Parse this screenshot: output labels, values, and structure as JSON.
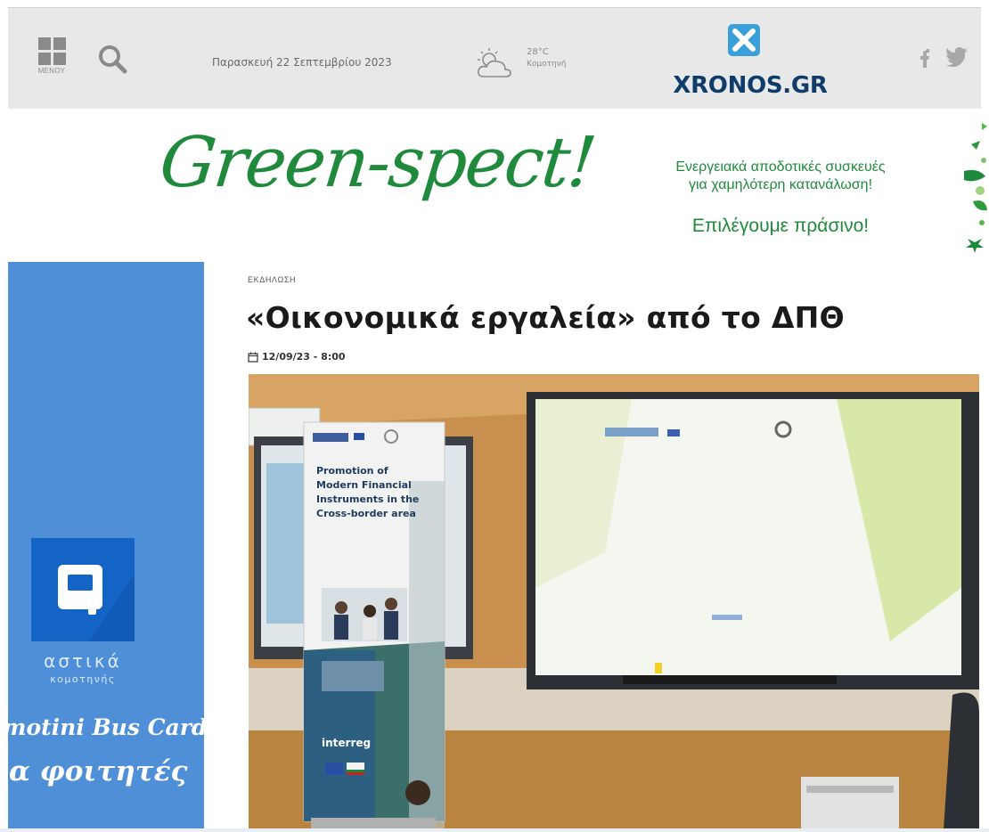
{
  "header": {
    "menu_label": "ΜΕΝΟΥ",
    "date": "Παρασκευή 22 Σεπτεμβρίου 2023",
    "weather": {
      "temperature": "28°C",
      "city": "Κομοτηνή",
      "icon": "partly-cloudy-icon"
    },
    "logo_text": "XRONOS.GR",
    "social": [
      "facebook-icon",
      "twitter-icon"
    ],
    "background": "#e8e8e8",
    "logo_color": "#0e3d6b"
  },
  "banner": {
    "headline": "Green-spect!",
    "line1": "Ενεργειακά αποδοτικές συσκευές",
    "line2": "για χαμηλότερη κατανάλωση!",
    "cta": "Επιλέγουμε πράσινο!",
    "color": "#1f8a3b"
  },
  "side_ad": {
    "brand": "αστικά",
    "brand_sub": "κομοτηνής",
    "line1": "motini Bus Card",
    "line2": "ια φοιτητές",
    "background": "#4e8fd8"
  },
  "article": {
    "category": "ΕΚΔΗΛΩΣΗ",
    "title": "«Οικονομικά εργαλεία» από το ΔΠΘ",
    "date": "12/09/23 - 8:00",
    "photo": {
      "banner_lines": [
        "Promotion of",
        "Modern Financial",
        "Instruments in the",
        "Cross-border area"
      ],
      "brand": "interreg"
    }
  }
}
